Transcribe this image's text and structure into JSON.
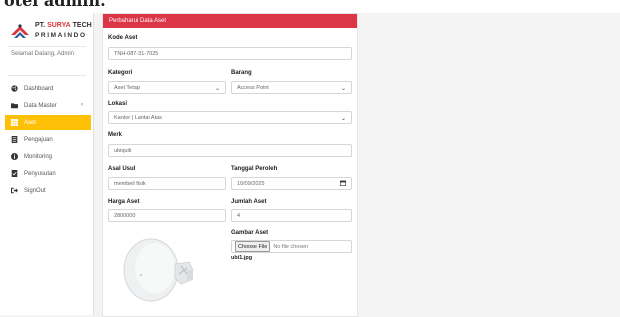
{
  "top_title": "otel admin.",
  "brand": {
    "name_part1": "PT.",
    "name_part2": "SURYA",
    "name_part3": "TECH",
    "sub": "PRIMAINDO"
  },
  "welcome": "Selamat Datang, Admin",
  "nav": [
    {
      "label": "Dashboard",
      "icon": "palette-icon",
      "active": false
    },
    {
      "label": "Data Master",
      "icon": "folder-icon",
      "active": false,
      "chevron": "‹"
    },
    {
      "label": "Aset",
      "icon": "grid-icon",
      "active": true
    },
    {
      "label": "Pengajuan",
      "icon": "document-icon",
      "active": false
    },
    {
      "label": "Monitoring",
      "icon": "info-icon",
      "active": false
    },
    {
      "label": "Penyusutan",
      "icon": "checklist-icon",
      "active": false
    },
    {
      "label": "SignOut",
      "icon": "signout-icon",
      "active": false
    }
  ],
  "form": {
    "header": "Perbaharui Data Aset",
    "kode_aset": {
      "label": "Kode Aset",
      "value": "TNH-087-31-7025"
    },
    "kategori": {
      "label": "Kategori",
      "value": "Aset Tetap"
    },
    "barang": {
      "label": "Barang",
      "value": "Access Point"
    },
    "lokasi": {
      "label": "Lokasi",
      "value": "Kantor | Lantai Atas"
    },
    "merk": {
      "label": "Merk",
      "value": "ubiquiti"
    },
    "asal_usul": {
      "label": "Asal Usul",
      "value": "membeli fisik"
    },
    "tanggal_peroleh": {
      "label": "Tanggal Peroleh",
      "value": "10/09/2025"
    },
    "harga_aset": {
      "label": "Harga Aset",
      "value": "2800000"
    },
    "jumlah_aset": {
      "label": "Jumlah Aset",
      "value": "4"
    },
    "gambar_aset": {
      "label": "Gambar Aset",
      "button": "Choose File",
      "no_file": "No file chosen",
      "filename": "ubi1.jpg"
    }
  },
  "colors": {
    "header_red": "#dc3545",
    "active_yellow": "#ffc107",
    "brand_red": "#d9363e"
  }
}
